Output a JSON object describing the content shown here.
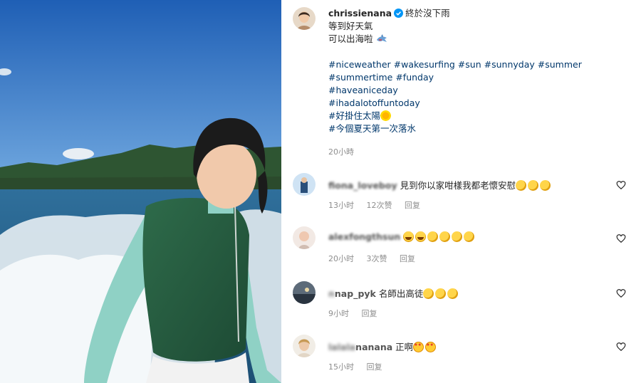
{
  "post": {
    "username": "chrissienana",
    "caption_lines": [
      "終於沒下雨",
      "等到好天氣",
      "可以出海啦"
    ],
    "hashtag_lines": [
      [
        "#niceweather",
        "#wakesurfing",
        "#sun",
        "#sunnyday",
        "#summer"
      ],
      [
        "#summertime",
        "#funday"
      ],
      [
        "#haveaniceday"
      ],
      [
        "#ihadalotoffuntoday"
      ],
      [
        "#好掛住太陽"
      ],
      [
        "#今個夏天第一次落水"
      ]
    ],
    "time": "20小時",
    "colors": {
      "link": "#00376b",
      "meta": "#8e8e8e",
      "verified": "#0095f6"
    }
  },
  "comments": [
    {
      "user": "fiona_loveboy",
      "text": "見到你以家咁樣我都老懷安慰",
      "emoji": [
        "clap",
        "clap",
        "clap"
      ],
      "time": "13小时",
      "likes": "12次赞",
      "reply": "回复"
    },
    {
      "user": "alexfongthsun",
      "text": "",
      "emoji": [
        "laugh",
        "laugh",
        "clap",
        "clap",
        "clap",
        "clap"
      ],
      "time": "20小时",
      "likes": "3次赞",
      "reply": "回复"
    },
    {
      "user_visible": "nap_pyk",
      "text": "名師出高徒",
      "emoji": [
        "clap",
        "clap",
        "clap"
      ],
      "time": "9小时",
      "likes": "",
      "reply": "回复"
    },
    {
      "user_visible": "nanana",
      "text": "正啊",
      "emoji": [
        "starry",
        "starry"
      ],
      "time": "15小时",
      "likes": "",
      "reply": "回复"
    }
  ]
}
